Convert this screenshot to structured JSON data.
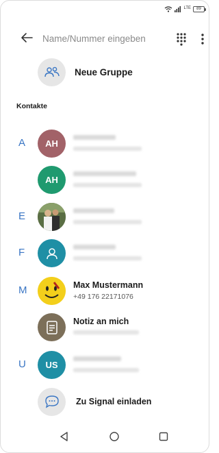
{
  "status_bar": {
    "network": "LTE",
    "battery": "89"
  },
  "search": {
    "placeholder": "Name/Nummer eingeben"
  },
  "new_group": {
    "label": "Neue Gruppe"
  },
  "contacts_section": {
    "title": "Kontakte"
  },
  "contacts": [
    {
      "letter": "A",
      "initials": "AH",
      "avatar_color": "#a26268",
      "name": "",
      "subtitle": "",
      "blurred": true
    },
    {
      "letter": "",
      "initials": "AH",
      "avatar_color": "#1f9a6f",
      "name": "",
      "subtitle": "",
      "blurred": true
    },
    {
      "letter": "E",
      "initials": "",
      "avatar_color": "#6f7f5a",
      "name": "",
      "subtitle": "",
      "blurred": true,
      "photo": true
    },
    {
      "letter": "F",
      "initials": "",
      "avatar_color": "#1f8fa5",
      "name": "",
      "subtitle": "",
      "blurred": true,
      "icon": "person-icon"
    },
    {
      "letter": "M",
      "initials": "",
      "avatar_color": "#f1cc1a",
      "name": "Max Mustermann",
      "subtitle": "+49 176 22171076",
      "blurred": false,
      "icon": "smiley-icon"
    },
    {
      "letter": "",
      "initials": "",
      "avatar_color": "#7c6f59",
      "name": "Notiz an mich",
      "subtitle": "",
      "blurred": true,
      "icon": "note-icon"
    },
    {
      "letter": "U",
      "initials": "US",
      "avatar_color": "#1f8fa5",
      "name": "",
      "subtitle": "",
      "blurred": true
    }
  ],
  "invite": {
    "label": "Zu Signal einladen"
  },
  "colors": {
    "accent_letter": "#3a76c4",
    "icon_blue": "#3a76c4"
  }
}
